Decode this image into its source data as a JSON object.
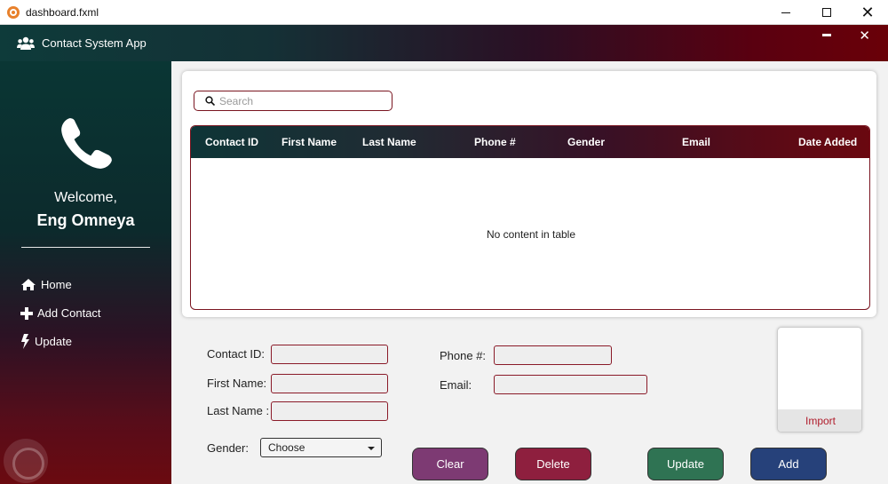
{
  "window": {
    "title": "dashboard.fxml"
  },
  "header": {
    "title": "Contact System App"
  },
  "sidebar": {
    "welcome": "Welcome,",
    "username": "Eng Omneya",
    "nav": [
      {
        "label": "Home",
        "icon": "home-icon"
      },
      {
        "label": "Add Contact",
        "icon": "plus-icon"
      },
      {
        "label": "Update",
        "icon": "bolt-icon"
      }
    ]
  },
  "search": {
    "placeholder": "Search",
    "value": ""
  },
  "table": {
    "columns": [
      "Contact ID",
      "First Name",
      "Last Name",
      "Phone #",
      "Gender",
      "Email",
      "Date Added"
    ],
    "rows": [],
    "empty_text": "No content in table"
  },
  "form": {
    "contact_id_label": "Contact ID:",
    "first_name_label": "First Name:",
    "last_name_label": "Last Name :",
    "phone_label": "Phone #:",
    "email_label": "Email:",
    "gender_label": "Gender:",
    "gender_selected": "Choose",
    "contact_id": "",
    "first_name": "",
    "last_name": "",
    "phone": "",
    "email": ""
  },
  "image_box": {
    "import_label": "Import"
  },
  "buttons": {
    "clear": "Clear",
    "delete": "Delete",
    "update": "Update",
    "add": "Add"
  },
  "colors": {
    "accent_dark": "#7a1520",
    "clear_button": "#7d3a73",
    "delete_button": "#8e1f3e",
    "update_button": "#2f7353",
    "add_button": "#26417a",
    "import_text": "#b01d2c"
  }
}
